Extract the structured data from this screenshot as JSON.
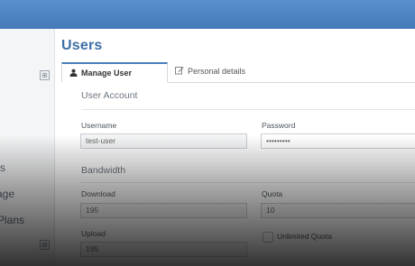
{
  "page": {
    "title": "Users"
  },
  "sidebar": {
    "items": [
      {
        "label": "s"
      },
      {
        "label": "age"
      },
      {
        "label": "Plans"
      }
    ],
    "expand_symbol": "⊞"
  },
  "tabs": [
    {
      "label": "Manage User",
      "icon": "user-icon",
      "active": true
    },
    {
      "label": "Personal details",
      "icon": "edit-icon",
      "active": false
    }
  ],
  "form": {
    "account_section": "User Account",
    "username_label": "Username",
    "username_value": "test-user",
    "password_label": "Password",
    "password_value": "•••••••••",
    "bandwidth_section": "Bandwidth",
    "download_label": "Download",
    "download_value": "195",
    "quota_label": "Quota",
    "quota_value": "10",
    "upload_label": "Upload",
    "upload_value": "195",
    "unlimited_quota_label": "Unlimited Quota"
  },
  "colors": {
    "topbar": "#4f84c3",
    "title": "#3d6fa6",
    "tab_accent": "#4a7fbf"
  }
}
